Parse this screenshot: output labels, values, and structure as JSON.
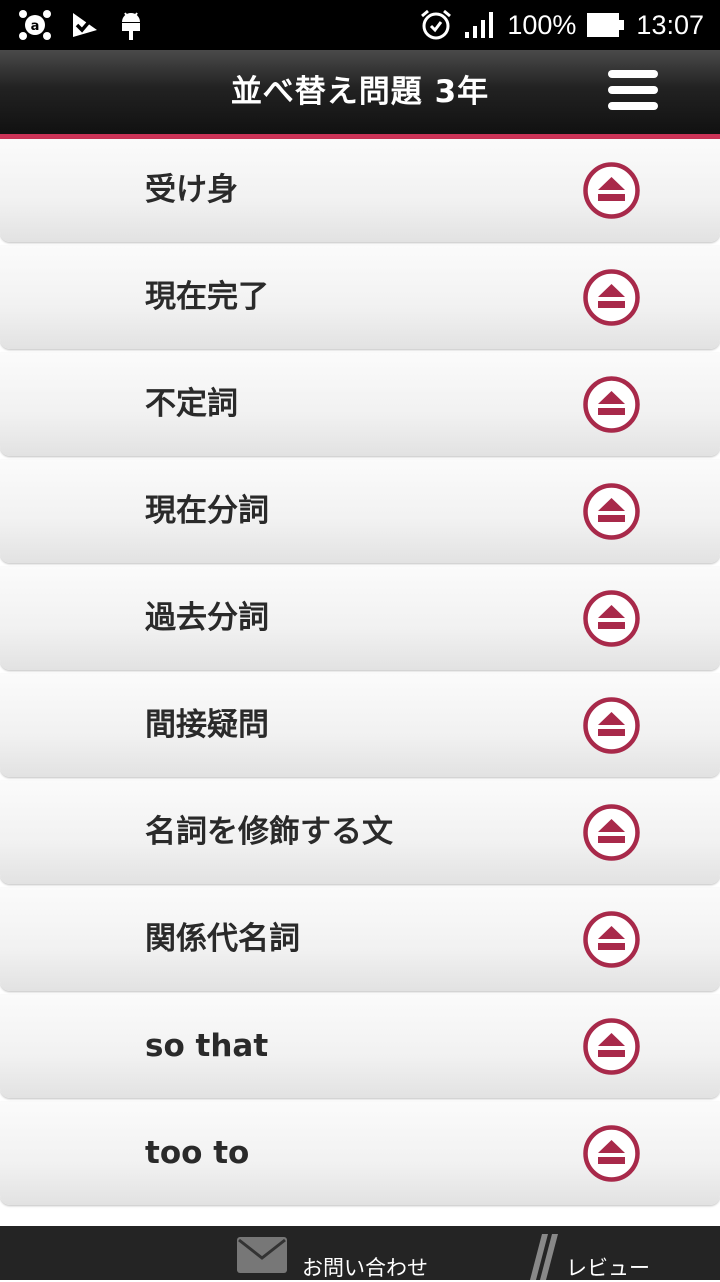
{
  "status_bar": {
    "battery": "100%",
    "time": "13:07",
    "icons": [
      "avast-icon",
      "checkmark-app-icon",
      "android-debug-icon",
      "alarm-icon",
      "signal-icon",
      "battery-icon"
    ]
  },
  "header": {
    "title": "並べ替え問題 3年",
    "menu_icon": "hamburger-menu-icon"
  },
  "accent_color": "#a8294a",
  "list": {
    "action_icon": "eject-icon",
    "items": [
      {
        "label": "受け身"
      },
      {
        "label": "現在完了"
      },
      {
        "label": "不定詞"
      },
      {
        "label": "現在分詞"
      },
      {
        "label": "過去分詞"
      },
      {
        "label": "間接疑問"
      },
      {
        "label": "名詞を修飾する文"
      },
      {
        "label": "関係代名詞"
      },
      {
        "label": "so that"
      },
      {
        "label": "too to"
      }
    ]
  },
  "footer": {
    "contact_label": "お問い合わせ",
    "contact_icon": "mail-icon",
    "review_label": "レビュー",
    "review_icon": "pencil-icon"
  }
}
